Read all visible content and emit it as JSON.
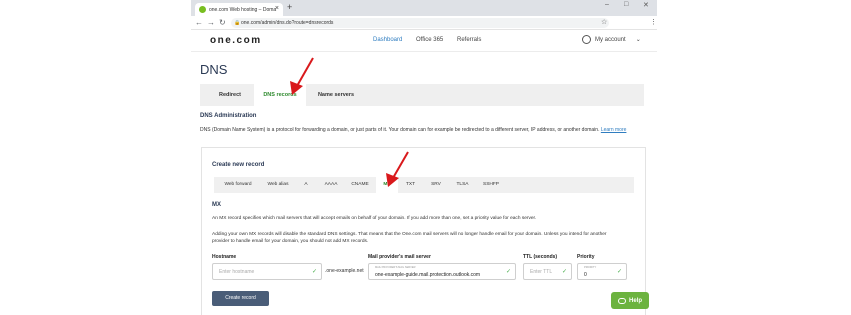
{
  "browser": {
    "tab_title": "one.com Web hosting  –  Doma",
    "tab_close": "×",
    "new_tab": "+",
    "url": "one.com/admin/dns.do?route=dnsrecords",
    "controls": {
      "minimize": "–",
      "maximize": "□",
      "close": "✕"
    },
    "nav": {
      "back": "←",
      "forward": "→",
      "reload": "↻"
    }
  },
  "header": {
    "logo": "one.com",
    "nav": [
      "Dashboard",
      "Office 365",
      "Referrals"
    ],
    "active_nav": "Dashboard",
    "account": "My account"
  },
  "page": {
    "title": "DNS",
    "tabs": [
      "Redirect",
      "DNS records",
      "Name servers"
    ],
    "active_tab": "DNS records",
    "section_title": "DNS Administration",
    "description": "DNS (Domain Name System) is a protocol for forwarding a domain, or just parts of it. Your domain can for example be redirected to a different server, IP address, or another domain.",
    "learn_more": "Learn more"
  },
  "create": {
    "title": "Create new record",
    "record_tabs": [
      "Web forward",
      "Web alias",
      "A",
      "AAAA",
      "CNAME",
      "MX",
      "TXT",
      "SRV",
      "TLSA",
      "SSHFP"
    ],
    "active_record_tab": "MX",
    "mx_title": "MX",
    "mx_text1": "An MX record specifies which mail servers that will accept emails on behalf of your domain. If you add more than one, set a priority value for each server.",
    "mx_text2": "Adding your own MX records will disable the standard DNS settings. That means that the One.com mail servers will no longer handle email for your domain. Unless you intend for another",
    "mx_text3": "provider to handle email for your domain, you should not add MX records.",
    "fields": {
      "hostname_label": "Hostname",
      "hostname_placeholder": "Enter hostname",
      "hostname_suffix": ".one-example.net",
      "mail_label": "Mail provider's mail server",
      "mail_tiny": "MAIL PROVIDER'S MAIL SERVER",
      "mail_value": "one-example-guide.mail.protection.outlook.com",
      "ttl_label": "TTL (seconds)",
      "ttl_placeholder": "Enter TTL",
      "priority_label": "Priority",
      "priority_tiny": "PRIORITY",
      "priority_value": "0"
    },
    "submit": "Create record"
  },
  "help": {
    "label": "Help"
  },
  "colors": {
    "accent_green": "#6cb33f",
    "active_tab_text": "#2e8a2e",
    "nav_active": "#2f7dc0",
    "button": "#4a5d78",
    "annotation_arrow": "#d9191c"
  }
}
